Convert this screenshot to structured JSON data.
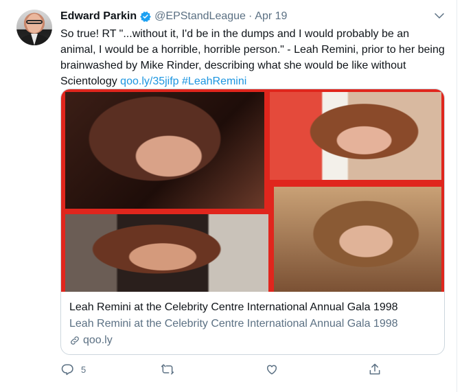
{
  "tweet": {
    "author_name": "Edward Parkin",
    "handle": "@EPStandLeague",
    "separator": "·",
    "date": "Apr 19",
    "body_text": "So true! RT \"...without it, I'd be in the dumps and I would probably be an animal, I would be a horrible, horrible person.\" - Leah Remini, prior to her being brainwashed by Mike Rinder, describing what she would be like without Scientology ",
    "link_text": "qoo.ly/35jifp",
    "hashtag": "#LeahRemini"
  },
  "card": {
    "title": "Leah Remini at the Celebrity Centre International Annual Gala 1998",
    "description": "Leah Remini at the Celebrity Centre International Annual Gala 1998",
    "domain": "qoo.ly"
  },
  "actions": {
    "reply_count": "5"
  },
  "colors": {
    "link": "#1b95e0",
    "secondary_text": "#5b7083",
    "verified": "#1da1f2",
    "media_frame": "#e0261d"
  },
  "icons": [
    "verified-badge-icon",
    "chevron-down-icon",
    "link-icon",
    "reply-icon",
    "retweet-icon",
    "like-icon",
    "share-icon"
  ]
}
